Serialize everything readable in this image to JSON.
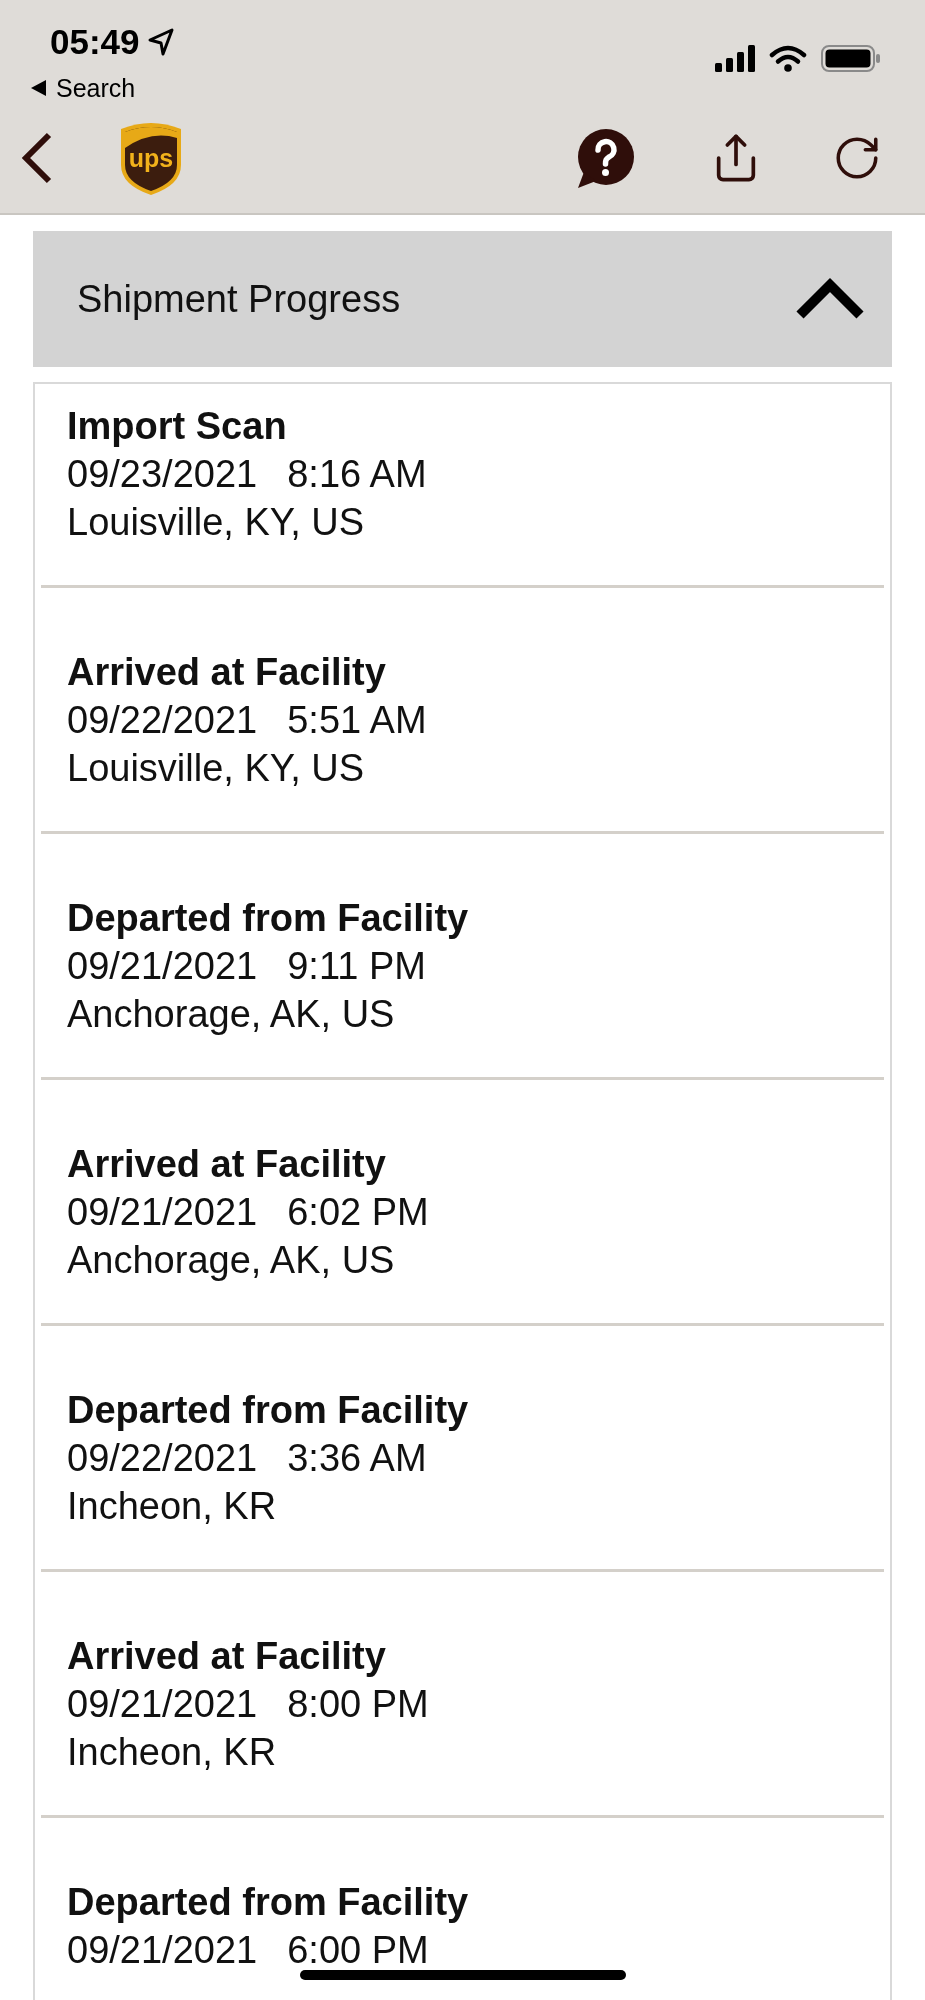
{
  "status_bar": {
    "time": "05:49",
    "back_label": "Search"
  },
  "logo": {
    "text": "ups"
  },
  "section": {
    "title": "Shipment Progress",
    "expanded": true
  },
  "events": [
    {
      "status": "Import Scan",
      "date": "09/23/2021",
      "time": "8:16 AM",
      "location": "Louisville, KY, US"
    },
    {
      "status": "Arrived at Facility",
      "date": "09/22/2021",
      "time": "5:51 AM",
      "location": "Louisville, KY, US"
    },
    {
      "status": "Departed from Facility",
      "date": "09/21/2021",
      "time": "9:11 PM",
      "location": "Anchorage, AK, US"
    },
    {
      "status": "Arrived at Facility",
      "date": "09/21/2021",
      "time": "6:02 PM",
      "location": "Anchorage, AK, US"
    },
    {
      "status": "Departed from Facility",
      "date": "09/22/2021",
      "time": "3:36 AM",
      "location": "Incheon, KR"
    },
    {
      "status": "Arrived at Facility",
      "date": "09/21/2021",
      "time": "8:00 PM",
      "location": "Incheon, KR"
    },
    {
      "status": "Departed from Facility",
      "date": "09/21/2021",
      "time": "6:00 PM"
    }
  ]
}
